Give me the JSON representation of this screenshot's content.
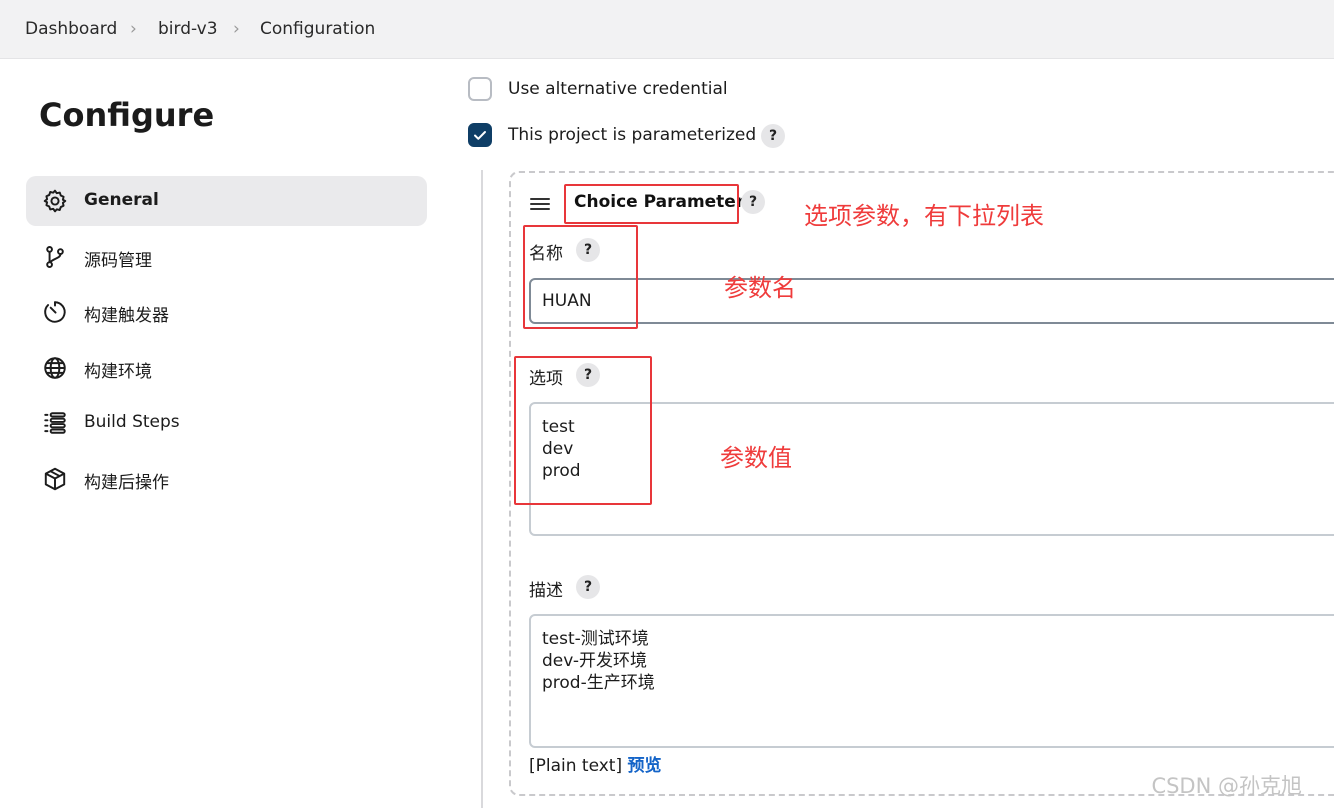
{
  "breadcrumb": {
    "items": [
      "Dashboard",
      "bird-v3",
      "Configuration"
    ]
  },
  "sidebar": {
    "title": "Configure",
    "items": [
      {
        "label": "General",
        "icon": "gear-icon",
        "active": true
      },
      {
        "label": "源码管理",
        "icon": "source-branch-icon"
      },
      {
        "label": "构建触发器",
        "icon": "timer-icon"
      },
      {
        "label": "构建环境",
        "icon": "globe-icon"
      },
      {
        "label": "Build Steps",
        "icon": "list-steps-icon"
      },
      {
        "label": "构建后操作",
        "icon": "package-icon"
      }
    ]
  },
  "main": {
    "use_alt_credential": {
      "label": "Use alternative credential",
      "checked": false
    },
    "parameterized": {
      "label": "This project is parameterized",
      "checked": true
    },
    "help_glyph": "?",
    "parameter": {
      "type_label": "Choice Parameter",
      "name_label": "名称",
      "name_value": "HUAN",
      "choices_label": "选项",
      "choices": [
        "test",
        "dev",
        "prod"
      ],
      "description_label": "描述",
      "description_lines": [
        "test-测试环境",
        "dev-开发环境",
        "prod-生产环境"
      ],
      "format_text": "[Plain text]",
      "preview_link": "预览"
    }
  },
  "annotations": {
    "type_note": "选项参数，有下拉列表",
    "name_note": "参数名",
    "choices_note": "参数值"
  },
  "watermark": "CSDN @孙克旭",
  "colors": {
    "checkbox_checked": "#0f3e66",
    "annotation_red": "#e8363a",
    "link_blue": "#1464c8"
  }
}
